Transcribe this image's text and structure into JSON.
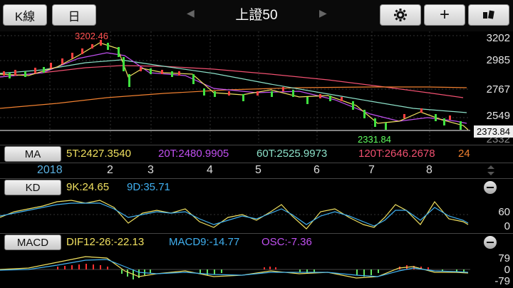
{
  "toolbar": {
    "kline_label": "K線",
    "period_label": "日",
    "title": "上證50",
    "prev_arrow": "◀",
    "next_arrow": "▶",
    "settings_icon": "gear-icon",
    "add_label": "+",
    "rotate_icon": "rotate-icon"
  },
  "price_axis": {
    "labels": [
      "3202",
      "2985",
      "2767",
      "2549",
      "2332"
    ],
    "current": "2373.84"
  },
  "annotations": {
    "high": "3202.46",
    "low": "2331.84"
  },
  "ma": {
    "button": "MA",
    "items": [
      {
        "label": "5T:2427.3540",
        "color": "#f0e060"
      },
      {
        "label": "20T:2480.9905",
        "color": "#c050f0"
      },
      {
        "label": "60T:2525.9973",
        "color": "#8ce0c8"
      },
      {
        "label": "120T:2646.2678",
        "color": "#f05070"
      },
      {
        "label": "24",
        "color": "#f08030"
      }
    ]
  },
  "months": [
    "2018",
    "2",
    "3",
    "4",
    "5",
    "6",
    "7",
    "8"
  ],
  "kd": {
    "button": "KD",
    "k": "9K:24.65",
    "d": "9D:35.71",
    "k_color": "#f0e060",
    "d_color": "#40b0f0",
    "axis": [
      "60",
      "0"
    ]
  },
  "macd": {
    "button": "MACD",
    "dif": "DIF12-26:-22.13",
    "macd9": "MACD9:-14.77",
    "osc": "OSC:-7.36",
    "dif_color": "#f0e060",
    "macd9_color": "#40b0f0",
    "osc_color": "#c050f0",
    "axis": [
      "79",
      "0",
      "-79"
    ]
  }
}
